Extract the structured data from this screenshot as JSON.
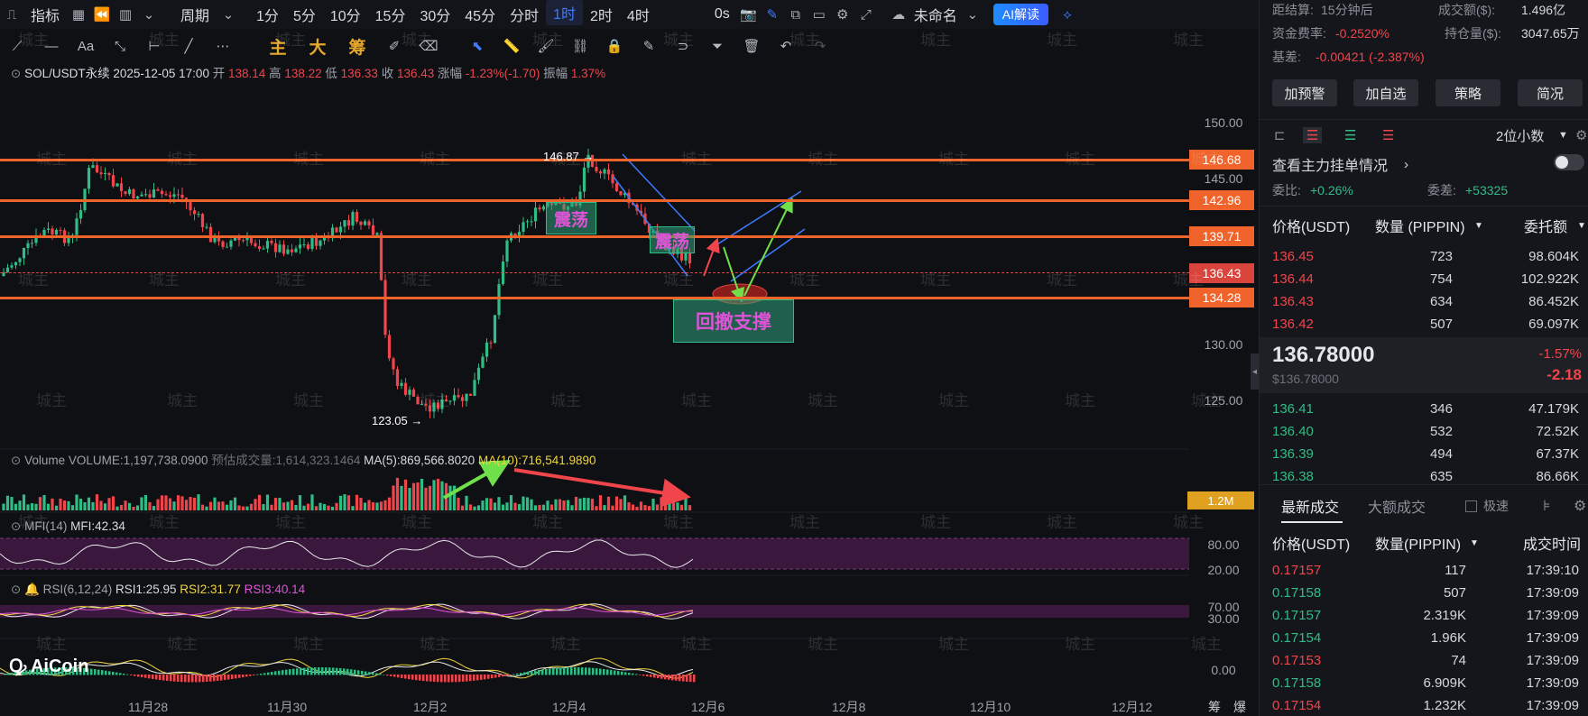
{
  "topbar": {
    "indicator_label": "指标",
    "period_label": "周期",
    "timeframes": [
      "1分",
      "5分",
      "10分",
      "15分",
      "30分",
      "45分",
      "分时",
      "1时",
      "2时",
      "4时"
    ],
    "active_timeframe": "1时",
    "zero_label": "0s",
    "layout_name": "未命名",
    "ai_label": "AI解读"
  },
  "toolbar2": {
    "zhu": "主",
    "da": "大",
    "chou": "筹",
    "aa": "Aa"
  },
  "legend": {
    "symbol": "SOL/USDT永续",
    "datetime": "2025-12-05 17:00",
    "open_label": "开",
    "open": "138.14",
    "high_label": "高",
    "high": "138.22",
    "low_label": "低",
    "low": "136.33",
    "close_label": "收",
    "close": "136.43",
    "change_label": "涨幅",
    "change": "-1.23%(-1.70)",
    "amp_label": "振幅",
    "amp": "1.37%"
  },
  "volume_legend": {
    "title": "Volume",
    "volume": "VOLUME:1,197,738.0900",
    "est": "预估成交量:1,614,323.1464",
    "ma5": "MA(5):869,566.8020",
    "ma10": "MA(10):716,541.9890",
    "axis_value": "1.2M"
  },
  "mfi_legend": {
    "title": "MFI(14)",
    "value": "MFI:42.34",
    "upper": "80.00",
    "lower": "20.00"
  },
  "rsi_legend": {
    "title": "RSI(6,12,24)",
    "rsi1": "RSI1:25.95",
    "rsi2": "RSI2:31.77",
    "rsi3": "RSI3:40.14",
    "upper": "70.00",
    "lower": "30.00"
  },
  "macd_zero": "0.00",
  "annotations": {
    "high_mark": "146.87",
    "low_mark": "123.05",
    "box1": "震荡",
    "box2": "震荡",
    "support": "回撤支撑"
  },
  "price_lines": [
    "146.68",
    "142.96",
    "139.71",
    "136.43",
    "134.28"
  ],
  "price_axis": [
    "150.00",
    "145.00",
    "130.00",
    "125.00"
  ],
  "x_axis": [
    "11月28",
    "11月30",
    "12月2",
    "12月4",
    "12月6",
    "12月8",
    "12月10",
    "12月12"
  ],
  "x_axis_extra": [
    "筹",
    "爆"
  ],
  "watermark": "城主",
  "logo": "AiCoin",
  "right_panel": {
    "distance_label": "距结算:",
    "distance_value": "15分钟后",
    "turnover_label": "成交额($):",
    "turnover_value": "1.496亿",
    "funding_label": "资金费率:",
    "funding_value": "-0.2520%",
    "oi_label": "持仓量($):",
    "oi_value": "3047.65万",
    "basis_label": "基差:",
    "basis_value": "-0.00421 (-2.387%)",
    "buttons": [
      "加预警",
      "加自选",
      "策略",
      "简况"
    ],
    "decimals": "2位小数",
    "depth_title": "查看主力挂单情况",
    "ratio_label": "委比:",
    "ratio_value": "+0.26%",
    "diff_label": "委差:",
    "diff_value": "+53325",
    "ob_headers": [
      "价格(USDT)",
      "数量 (PIPPIN)",
      "委托额"
    ],
    "asks": [
      {
        "p": "136.45",
        "q": "723",
        "a": "98.604K"
      },
      {
        "p": "136.44",
        "q": "754",
        "a": "102.922K"
      },
      {
        "p": "136.43",
        "q": "634",
        "a": "86.452K"
      },
      {
        "p": "136.42",
        "q": "507",
        "a": "69.097K"
      }
    ],
    "last_price": "136.78000",
    "last_usd": "$136.78000",
    "last_pct": "-1.57%",
    "last_chg": "-2.18",
    "bids": [
      {
        "p": "136.41",
        "q": "346",
        "a": "47.179K"
      },
      {
        "p": "136.40",
        "q": "532",
        "a": "72.52K"
      },
      {
        "p": "136.39",
        "q": "494",
        "a": "67.37K"
      },
      {
        "p": "136.38",
        "q": "635",
        "a": "86.66K"
      }
    ],
    "trade_tabs": [
      "最新成交",
      "大额成交"
    ],
    "fast_label": "极速",
    "trade_headers": [
      "价格(USDT)",
      "数量(PIPPIN)",
      "成交时间"
    ],
    "trades": [
      {
        "p": "0.17157",
        "q": "117",
        "t": "17:39:10",
        "side": "sell"
      },
      {
        "p": "0.17158",
        "q": "507",
        "t": "17:39:09",
        "side": "buy"
      },
      {
        "p": "0.17157",
        "q": "2.319K",
        "t": "17:39:09",
        "side": "buy"
      },
      {
        "p": "0.17154",
        "q": "1.96K",
        "t": "17:39:09",
        "side": "buy"
      },
      {
        "p": "0.17153",
        "q": "74",
        "t": "17:39:09",
        "side": "sell"
      },
      {
        "p": "0.17158",
        "q": "6.909K",
        "t": "17:39:09",
        "side": "buy"
      },
      {
        "p": "0.17154",
        "q": "1.232K",
        "t": "17:39:09",
        "side": "sell"
      }
    ]
  },
  "colors": {
    "accent": "#3d7bff",
    "up": "#2fbd85",
    "down": "#f0454b",
    "level": "#f0632a"
  }
}
